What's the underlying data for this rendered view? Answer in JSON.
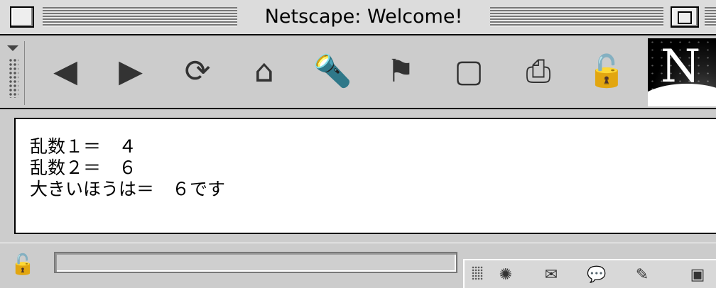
{
  "window": {
    "title": "Netscape: Welcome!"
  },
  "toolbar": {
    "buttons": [
      {
        "name": "back-icon",
        "glyph": "◀"
      },
      {
        "name": "forward-icon",
        "glyph": "▶"
      },
      {
        "name": "reload-icon",
        "glyph": "⟳"
      },
      {
        "name": "home-icon",
        "glyph": "⌂"
      },
      {
        "name": "search-icon",
        "glyph": "🔦"
      },
      {
        "name": "guide-icon",
        "glyph": "⚑"
      },
      {
        "name": "images-icon",
        "glyph": "▢"
      },
      {
        "name": "print-icon",
        "glyph": "⎙"
      },
      {
        "name": "security-icon",
        "glyph": "🔓"
      }
    ],
    "logo_letter": "N"
  },
  "content": {
    "lines": [
      "乱数１＝　４",
      "乱数２＝　６",
      "大きいほうは＝　６です"
    ]
  },
  "statusbar": {
    "lock_glyph": "🔓",
    "components": [
      {
        "name": "navigator-icon",
        "glyph": "✺"
      },
      {
        "name": "mail-icon",
        "glyph": "✉"
      },
      {
        "name": "discussion-icon",
        "glyph": "💬"
      },
      {
        "name": "composer-icon",
        "glyph": "✎"
      },
      {
        "name": "window-icon",
        "glyph": "▣"
      }
    ]
  },
  "colors": {
    "chrome": "#cccccc",
    "content_bg": "#ffffff",
    "text": "#000000"
  }
}
